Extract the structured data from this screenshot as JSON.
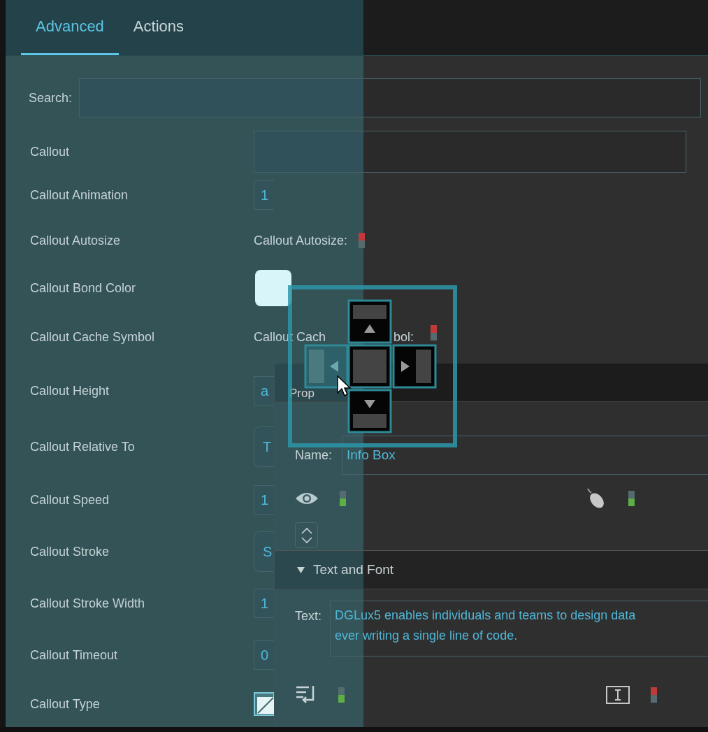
{
  "tabs": [
    {
      "label": "Advanced",
      "selected": true
    },
    {
      "label": "Actions",
      "selected": false
    }
  ],
  "search": {
    "label": "Search:"
  },
  "rows": [
    {
      "label": "Callout",
      "kind": "text"
    },
    {
      "label": "Callout Animation",
      "kind": "number",
      "value": "1"
    },
    {
      "label": "Callout Autosize",
      "kind": "toggle",
      "caption": "Callout Autosize:",
      "on": false
    },
    {
      "label": "Callout Bond Color",
      "kind": "color",
      "color": "#d8f6fa"
    },
    {
      "label": "Callout Cache Symbol",
      "kind": "toggle",
      "caption": [
        "Callout Cach",
        "bol:"
      ],
      "on": false
    },
    {
      "label": "Callout Height",
      "kind": "number",
      "value": "a"
    },
    {
      "label": "Callout Relative To",
      "kind": "dropdown",
      "value": "T"
    },
    {
      "label": "Callout Speed",
      "kind": "number",
      "value": "1"
    },
    {
      "label": "Callout Stroke",
      "kind": "dropdown",
      "value": "S"
    },
    {
      "label": "Callout Stroke Width",
      "kind": "number",
      "value": "1"
    },
    {
      "label": "Callout Timeout",
      "kind": "number",
      "value": "0"
    },
    {
      "label": "Callout Type",
      "kind": "picker"
    }
  ],
  "properties_panel": {
    "title": "Prop",
    "name_label": "Name:",
    "name": "Info Box",
    "visible_on": true,
    "mouse_on": true,
    "section": {
      "title": "Text and Font",
      "expanded": true
    },
    "text_label": "Text:",
    "text_lines": [
      "DGLux5 enables individuals and teams to design data",
      "ever writing a single line of code."
    ],
    "wrap_on": true,
    "selectable_on": false
  }
}
